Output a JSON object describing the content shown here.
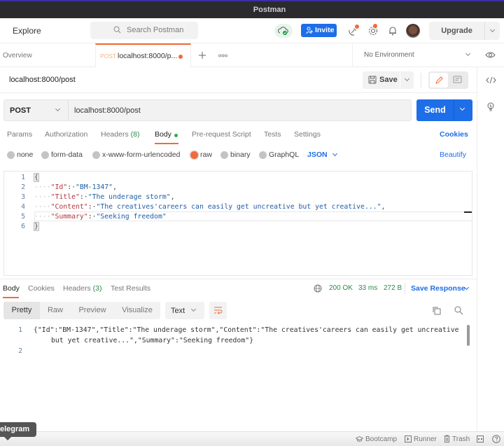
{
  "app": {
    "title": "Postman"
  },
  "header": {
    "explore_label": "Explore",
    "search_placeholder": "Search Postman",
    "invite_label": "Invite",
    "upgrade_label": "Upgrade",
    "icons": [
      "cloud-sync-icon",
      "satellite-icon",
      "gear-icon",
      "bell-icon",
      "avatar"
    ]
  },
  "tabs": {
    "overview_label": "Overview",
    "active_tab": {
      "method": "POST",
      "name": "localhost:8000/p...",
      "unsaved": true
    },
    "environment": "No Environment"
  },
  "request": {
    "name": "localhost:8000/post",
    "save_label": "Save",
    "method": "POST",
    "url": "localhost:8000/post",
    "send_label": "Send",
    "tabs": [
      {
        "label": "Params"
      },
      {
        "label": "Authorization"
      },
      {
        "label": "Headers",
        "count": "(8)"
      },
      {
        "label": "Body",
        "active": true
      },
      {
        "label": "Pre-request Script"
      },
      {
        "label": "Tests"
      },
      {
        "label": "Settings"
      }
    ],
    "cookies_label": "Cookies",
    "body_types": [
      "none",
      "form-data",
      "x-www-form-urlencoded",
      "raw",
      "binary",
      "GraphQL"
    ],
    "selected_body_type": "raw",
    "format": "JSON",
    "beautify_label": "Beautify",
    "body_lines": [
      {
        "n": "1",
        "text": "{"
      },
      {
        "n": "2",
        "key": "\"Id\"",
        "value": "\"BM-1347\"",
        "trail": ","
      },
      {
        "n": "3",
        "key": "\"Title\"",
        "value": "\"The underage storm\"",
        "trail": ","
      },
      {
        "n": "4",
        "key": "\"Content\"",
        "value": "\"The creatives'careers can easily get uncreative but yet creative...\"",
        "trail": ","
      },
      {
        "n": "5",
        "key": "\"Summary\"",
        "value": "\"Seeking freedom\"",
        "trail": ""
      },
      {
        "n": "6",
        "text": "}"
      }
    ]
  },
  "response": {
    "tabs": [
      {
        "label": "Body",
        "active": true
      },
      {
        "label": "Cookies"
      },
      {
        "label": "Headers",
        "count": "(3)"
      },
      {
        "label": "Test Results"
      }
    ],
    "status": "200 OK",
    "time": "33 ms",
    "size": "272 B",
    "save_response_label": "Save Response",
    "views": [
      "Pretty",
      "Raw",
      "Preview",
      "Visualize"
    ],
    "selected_view": "Pretty",
    "format": "Text",
    "lines": [
      {
        "n": "1",
        "text": "{\"Id\":\"BM-1347\",\"Title\":\"The underage storm\",\"Content\":\"The creatives'careers can easily get uncreative",
        "cont": "but yet creative...\",\"Summary\":\"Seeking freedom\"}"
      },
      {
        "n": "2",
        "text": ""
      }
    ]
  },
  "footer": {
    "tooltip": "elegram",
    "bootcamp_label": "Bootcamp",
    "runner_label": "Runner",
    "trash_label": "Trash"
  },
  "colors": {
    "accent_orange": "#f26b3a",
    "primary_blue": "#1d6ee8",
    "status_green": "#2c8a4a"
  }
}
